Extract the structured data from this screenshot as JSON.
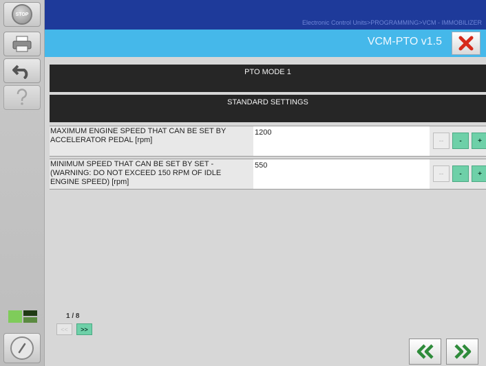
{
  "header": {
    "breadcrumb": "Electronic Control Units>PROGRAMMING>VCM - IMMOBILIZER",
    "app_title": "VCM-PTO v1.5"
  },
  "sidebar": {
    "stop_label": "STOP"
  },
  "sections": {
    "mode_title": "PTO MODE 1",
    "settings_title": "STANDARD SETTINGS"
  },
  "params": [
    {
      "label": "MAXIMUM ENGINE SPEED THAT CAN BE SET BY ACCELERATOR PEDAL  [rpm]",
      "value": "1200",
      "buttons": [
        "--",
        "-",
        "+",
        "++"
      ]
    },
    {
      "label": "MINIMUM SPEED THAT CAN BE SET BY SET - (WARNING: DO NOT EXCEED 150 RPM OF IDLE ENGINE SPEED)  [rpm]",
      "value": "550",
      "buttons": [
        "--",
        "-",
        "+",
        "++"
      ]
    }
  ],
  "pager": {
    "indicator": "1 / 8",
    "prev_label": "<<",
    "next_label": ">>"
  },
  "colors": {
    "breadcrumb_bar": "#1e3a9a",
    "title_bar": "#45b8ea",
    "section_bar": "#262626",
    "accent_button": "#6ed0a8",
    "close_icon": "#d62a1a",
    "nav_arrow": "#2e8b3a"
  }
}
